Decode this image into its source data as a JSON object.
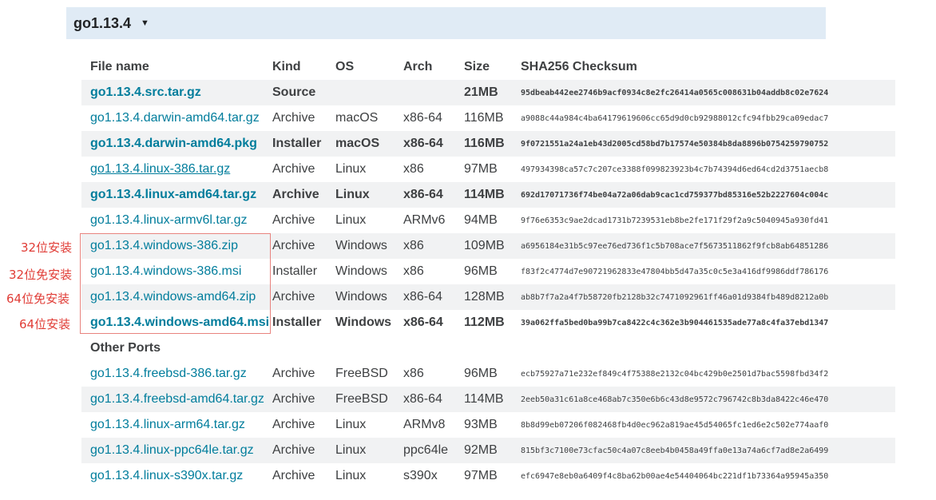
{
  "version": {
    "title": "go1.13.4",
    "caret": "▼"
  },
  "table": {
    "headers": {
      "file": "File name",
      "kind": "Kind",
      "os": "OS",
      "arch": "Arch",
      "size": "Size",
      "sha": "SHA256 Checksum"
    },
    "rows": [
      {
        "file": "go1.13.4.src.tar.gz",
        "kind": "Source",
        "os": "",
        "arch": "",
        "size": "21MB",
        "sha": "95dbeab442ee2746b9acf0934c8e2fc26414a0565c008631b04addb8c02e7624"
      },
      {
        "file": "go1.13.4.darwin-amd64.tar.gz",
        "kind": "Archive",
        "os": "macOS",
        "arch": "x86-64",
        "size": "116MB",
        "sha": "a9088c44a984c4ba64179619606cc65d9d0cb92988012cfc94fbb29ca09edac7"
      },
      {
        "file": "go1.13.4.darwin-amd64.pkg",
        "kind": "Installer",
        "os": "macOS",
        "arch": "x86-64",
        "size": "116MB",
        "sha": "9f0721551a24a1eb43d2005cd58bd7b17574e50384b8da8896b0754259790752"
      },
      {
        "file": "go1.13.4.linux-386.tar.gz",
        "kind": "Archive",
        "os": "Linux",
        "arch": "x86",
        "size": "97MB",
        "sha": "497934398ca57c7c207ce3388f099823923b4c7b74394d6ed64cd2d3751aecb8"
      },
      {
        "file": "go1.13.4.linux-amd64.tar.gz",
        "kind": "Archive",
        "os": "Linux",
        "arch": "x86-64",
        "size": "114MB",
        "sha": "692d17071736f74be04a72a06dab9cac1cd759377bd85316e52b2227604c004c"
      },
      {
        "file": "go1.13.4.linux-armv6l.tar.gz",
        "kind": "Archive",
        "os": "Linux",
        "arch": "ARMv6",
        "size": "94MB",
        "sha": "9f76e6353c9ae2dcad1731b7239531eb8be2fe171f29f2a9c5040945a930fd41"
      },
      {
        "file": "go1.13.4.windows-386.zip",
        "kind": "Archive",
        "os": "Windows",
        "arch": "x86",
        "size": "109MB",
        "sha": "a6956184e31b5c97ee76ed736f1c5b708ace7f5673511862f9fcb8ab64851286"
      },
      {
        "file": "go1.13.4.windows-386.msi",
        "kind": "Installer",
        "os": "Windows",
        "arch": "x86",
        "size": "96MB",
        "sha": "f83f2c4774d7e90721962833e47804bb5d47a35c0c5e3a416df9986ddf786176"
      },
      {
        "file": "go1.13.4.windows-amd64.zip",
        "kind": "Archive",
        "os": "Windows",
        "arch": "x86-64",
        "size": "128MB",
        "sha": "ab8b7f7a2a4f7b58720fb2128b32c7471092961ff46a01d9384fb489d8212a0b"
      },
      {
        "file": "go1.13.4.windows-amd64.msi",
        "kind": "Installer",
        "os": "Windows",
        "arch": "x86-64",
        "size": "112MB",
        "sha": "39a062ffa5bed0ba99b7ca8422c4c362e3b904461535ade77a8c4fa37ebd1347"
      }
    ],
    "other_ports_label": "Other Ports",
    "other_rows": [
      {
        "file": "go1.13.4.freebsd-386.tar.gz",
        "kind": "Archive",
        "os": "FreeBSD",
        "arch": "x86",
        "size": "96MB",
        "sha": "ecb75927a71e232ef849c4f75388e2132c04bc429b0e2501d7bac5598fbd34f2"
      },
      {
        "file": "go1.13.4.freebsd-amd64.tar.gz",
        "kind": "Archive",
        "os": "FreeBSD",
        "arch": "x86-64",
        "size": "114MB",
        "sha": "2eeb50a31c61a8ce468ab7c350e6b6c43d8e9572c796742c8b3da8422c46e470"
      },
      {
        "file": "go1.13.4.linux-arm64.tar.gz",
        "kind": "Archive",
        "os": "Linux",
        "arch": "ARMv8",
        "size": "93MB",
        "sha": "8b8d99eb07206f082468fb4d0ec962a819ae45d54065fc1ed6e2c502e774aaf0"
      },
      {
        "file": "go1.13.4.linux-ppc64le.tar.gz",
        "kind": "Archive",
        "os": "Linux",
        "arch": "ppc64le",
        "size": "92MB",
        "sha": "815bf3c7100e73cfac50c4a07c8eeb4b0458a49ffa0e13a74a6cf7ad8e2a6499"
      },
      {
        "file": "go1.13.4.linux-s390x.tar.gz",
        "kind": "Archive",
        "os": "Linux",
        "arch": "s390x",
        "size": "97MB",
        "sha": "efc6947e8eb0a6409f4c8ba62b00ae4e54404064bc221df1b73364a95945a350"
      }
    ]
  },
  "annotations": {
    "win386_zip": "32位安装",
    "win386_msi": "32位免安装",
    "winamd64_zip": "64位免安装",
    "winamd64_msi": "64位安装"
  },
  "colors": {
    "link": "#007d9c",
    "header_bg": "#e0ebf5",
    "row_shade": "#f1f2f3",
    "annotation": "#e03c36"
  }
}
